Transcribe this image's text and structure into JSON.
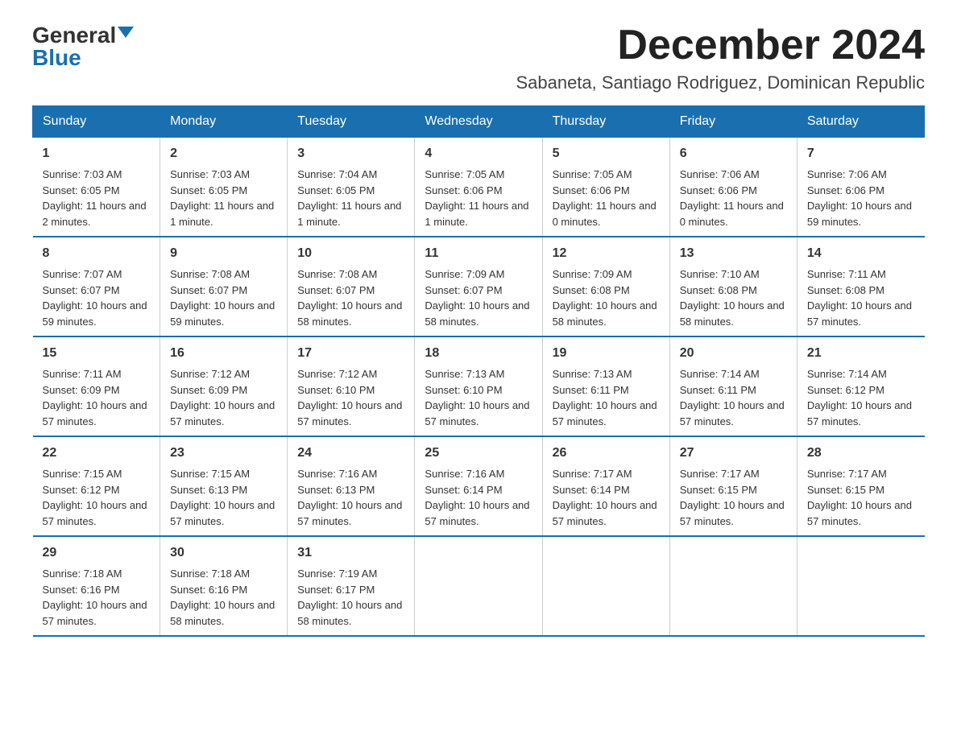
{
  "header": {
    "logo_general": "General",
    "logo_blue": "Blue",
    "month_title": "December 2024",
    "subtitle": "Sabaneta, Santiago Rodriguez, Dominican Republic"
  },
  "days_of_week": [
    "Sunday",
    "Monday",
    "Tuesday",
    "Wednesday",
    "Thursday",
    "Friday",
    "Saturday"
  ],
  "weeks": [
    [
      {
        "day": "1",
        "sunrise": "7:03 AM",
        "sunset": "6:05 PM",
        "daylight": "11 hours and 2 minutes."
      },
      {
        "day": "2",
        "sunrise": "7:03 AM",
        "sunset": "6:05 PM",
        "daylight": "11 hours and 1 minute."
      },
      {
        "day": "3",
        "sunrise": "7:04 AM",
        "sunset": "6:05 PM",
        "daylight": "11 hours and 1 minute."
      },
      {
        "day": "4",
        "sunrise": "7:05 AM",
        "sunset": "6:06 PM",
        "daylight": "11 hours and 1 minute."
      },
      {
        "day": "5",
        "sunrise": "7:05 AM",
        "sunset": "6:06 PM",
        "daylight": "11 hours and 0 minutes."
      },
      {
        "day": "6",
        "sunrise": "7:06 AM",
        "sunset": "6:06 PM",
        "daylight": "11 hours and 0 minutes."
      },
      {
        "day": "7",
        "sunrise": "7:06 AM",
        "sunset": "6:06 PM",
        "daylight": "10 hours and 59 minutes."
      }
    ],
    [
      {
        "day": "8",
        "sunrise": "7:07 AM",
        "sunset": "6:07 PM",
        "daylight": "10 hours and 59 minutes."
      },
      {
        "day": "9",
        "sunrise": "7:08 AM",
        "sunset": "6:07 PM",
        "daylight": "10 hours and 59 minutes."
      },
      {
        "day": "10",
        "sunrise": "7:08 AM",
        "sunset": "6:07 PM",
        "daylight": "10 hours and 58 minutes."
      },
      {
        "day": "11",
        "sunrise": "7:09 AM",
        "sunset": "6:07 PM",
        "daylight": "10 hours and 58 minutes."
      },
      {
        "day": "12",
        "sunrise": "7:09 AM",
        "sunset": "6:08 PM",
        "daylight": "10 hours and 58 minutes."
      },
      {
        "day": "13",
        "sunrise": "7:10 AM",
        "sunset": "6:08 PM",
        "daylight": "10 hours and 58 minutes."
      },
      {
        "day": "14",
        "sunrise": "7:11 AM",
        "sunset": "6:08 PM",
        "daylight": "10 hours and 57 minutes."
      }
    ],
    [
      {
        "day": "15",
        "sunrise": "7:11 AM",
        "sunset": "6:09 PM",
        "daylight": "10 hours and 57 minutes."
      },
      {
        "day": "16",
        "sunrise": "7:12 AM",
        "sunset": "6:09 PM",
        "daylight": "10 hours and 57 minutes."
      },
      {
        "day": "17",
        "sunrise": "7:12 AM",
        "sunset": "6:10 PM",
        "daylight": "10 hours and 57 minutes."
      },
      {
        "day": "18",
        "sunrise": "7:13 AM",
        "sunset": "6:10 PM",
        "daylight": "10 hours and 57 minutes."
      },
      {
        "day": "19",
        "sunrise": "7:13 AM",
        "sunset": "6:11 PM",
        "daylight": "10 hours and 57 minutes."
      },
      {
        "day": "20",
        "sunrise": "7:14 AM",
        "sunset": "6:11 PM",
        "daylight": "10 hours and 57 minutes."
      },
      {
        "day": "21",
        "sunrise": "7:14 AM",
        "sunset": "6:12 PM",
        "daylight": "10 hours and 57 minutes."
      }
    ],
    [
      {
        "day": "22",
        "sunrise": "7:15 AM",
        "sunset": "6:12 PM",
        "daylight": "10 hours and 57 minutes."
      },
      {
        "day": "23",
        "sunrise": "7:15 AM",
        "sunset": "6:13 PM",
        "daylight": "10 hours and 57 minutes."
      },
      {
        "day": "24",
        "sunrise": "7:16 AM",
        "sunset": "6:13 PM",
        "daylight": "10 hours and 57 minutes."
      },
      {
        "day": "25",
        "sunrise": "7:16 AM",
        "sunset": "6:14 PM",
        "daylight": "10 hours and 57 minutes."
      },
      {
        "day": "26",
        "sunrise": "7:17 AM",
        "sunset": "6:14 PM",
        "daylight": "10 hours and 57 minutes."
      },
      {
        "day": "27",
        "sunrise": "7:17 AM",
        "sunset": "6:15 PM",
        "daylight": "10 hours and 57 minutes."
      },
      {
        "day": "28",
        "sunrise": "7:17 AM",
        "sunset": "6:15 PM",
        "daylight": "10 hours and 57 minutes."
      }
    ],
    [
      {
        "day": "29",
        "sunrise": "7:18 AM",
        "sunset": "6:16 PM",
        "daylight": "10 hours and 57 minutes."
      },
      {
        "day": "30",
        "sunrise": "7:18 AM",
        "sunset": "6:16 PM",
        "daylight": "10 hours and 58 minutes."
      },
      {
        "day": "31",
        "sunrise": "7:19 AM",
        "sunset": "6:17 PM",
        "daylight": "10 hours and 58 minutes."
      },
      {
        "day": "",
        "sunrise": "",
        "sunset": "",
        "daylight": ""
      },
      {
        "day": "",
        "sunrise": "",
        "sunset": "",
        "daylight": ""
      },
      {
        "day": "",
        "sunrise": "",
        "sunset": "",
        "daylight": ""
      },
      {
        "day": "",
        "sunrise": "",
        "sunset": "",
        "daylight": ""
      }
    ]
  ]
}
